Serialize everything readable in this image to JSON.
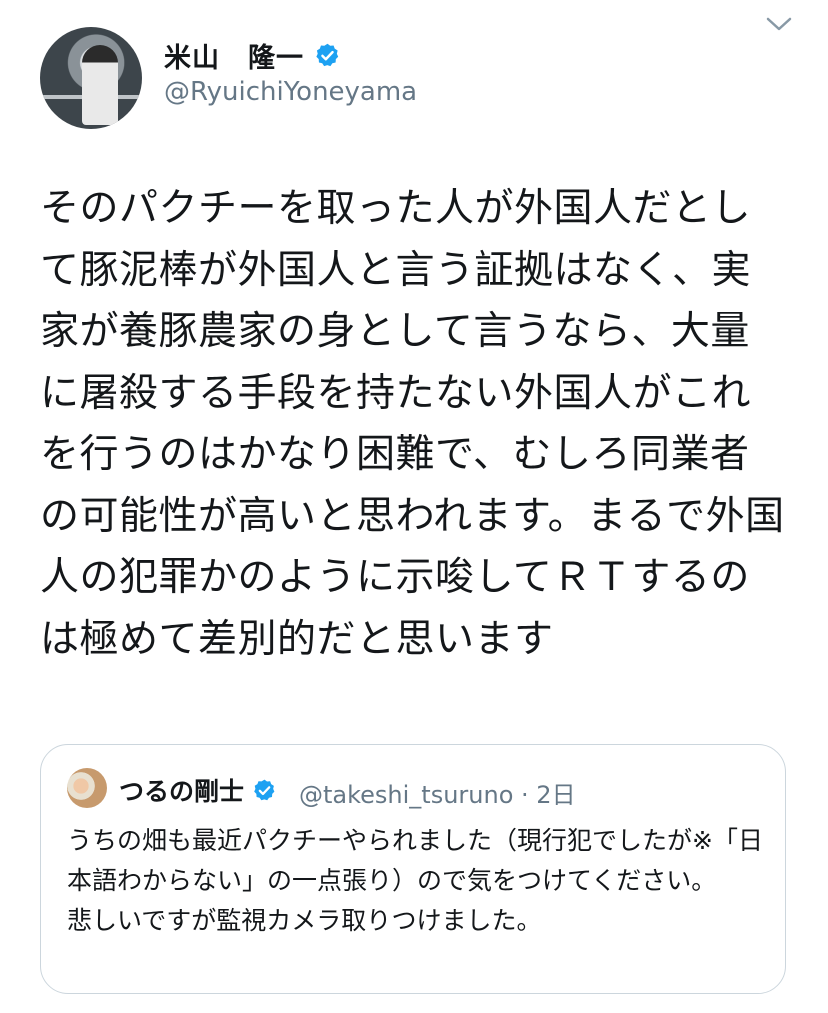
{
  "tweet": {
    "author_name": "米山　隆一",
    "handle": "@RyuichiYoneyama",
    "text": "そのパクチーを取った人が外国人だとして豚泥棒が外国人と言う証拠はなく、実家が養豚農家の身として言うなら、大量に屠殺する手段を持たない外国人がこれを行うのはかなり困難で、むしろ同業者の可能性が高いと思われます。まるで外国人の犯罪かのように示唆してＲＴするのは極めて差別的だと思います"
  },
  "quote": {
    "author_name": "つるの剛士",
    "handle": "@takeshi_tsuruno",
    "time": "2日",
    "separator": " · ",
    "text": "うちの畑も最近パクチーやられました（現行犯でしたが※「日本語わからない」の一点張り）ので気をつけてください。\n悲しいですが監視カメラ取りつけました。"
  },
  "icons": {
    "verified": "verified-badge-icon",
    "chevron": "chevron-down-icon"
  },
  "colors": {
    "verified": "#1da1f2",
    "secondary_text": "#657786",
    "border": "#ccd6dd",
    "text": "#14171a"
  }
}
